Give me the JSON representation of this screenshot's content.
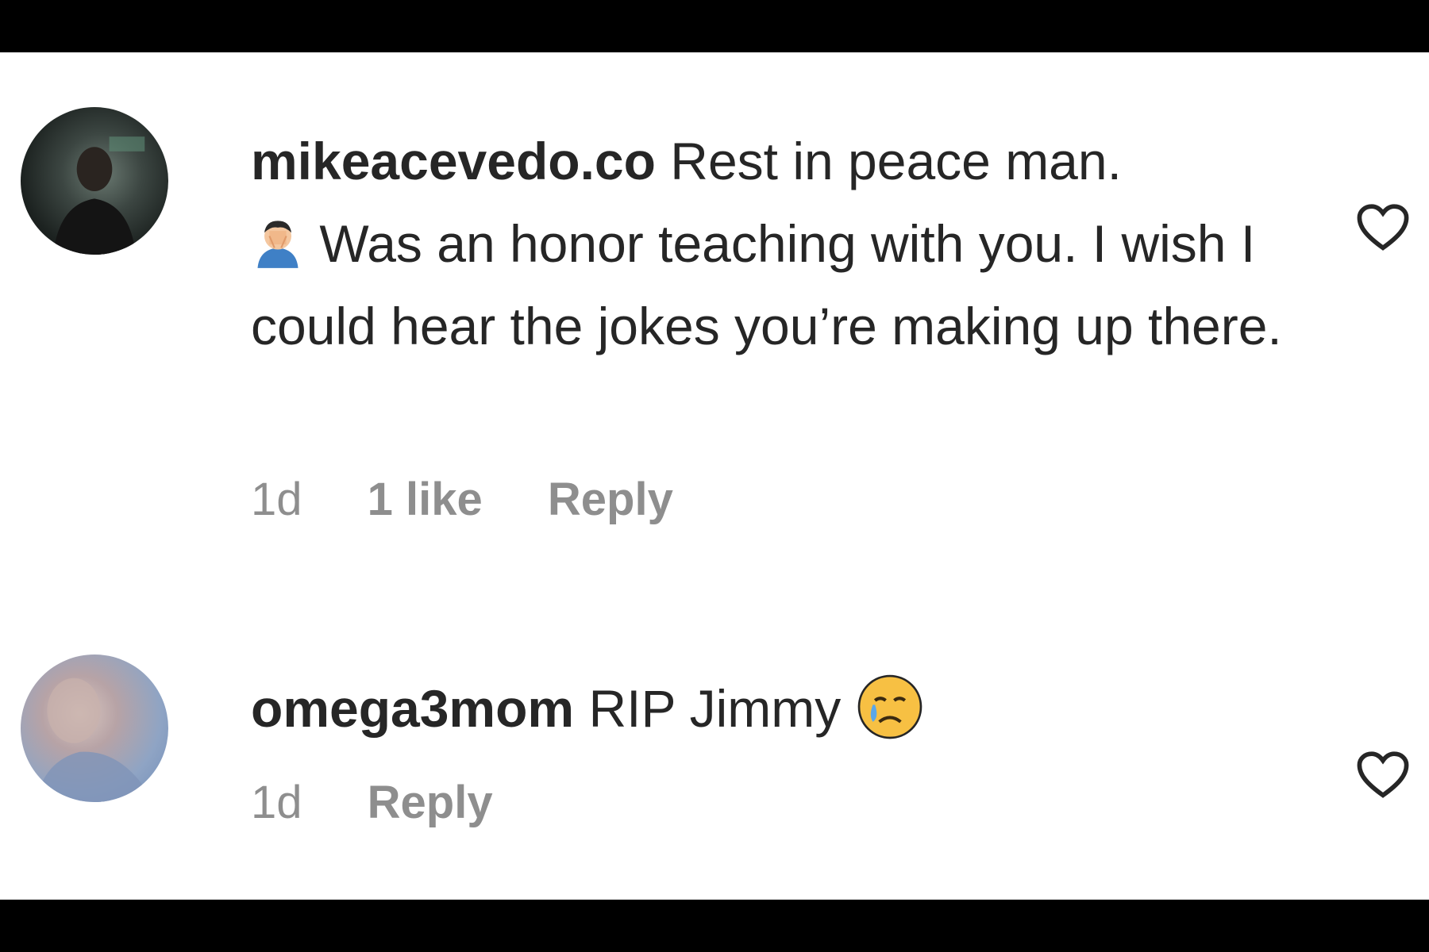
{
  "comments": [
    {
      "username": "mikeacevedo.co",
      "text_part1": "Rest in peace man.",
      "emoji1": "person-facepalming",
      "text_part2": "Was an honor teaching with you. I wish I could hear the jokes you’re making up there.",
      "time": "1d",
      "likes": "1 like",
      "reply_label": "Reply",
      "like_icon": "heart-outline-icon"
    },
    {
      "username": "omega3mom",
      "text_part1": "RIP Jimmy",
      "emoji1": "crying-face",
      "time": "1d",
      "reply_label": "Reply",
      "like_icon": "heart-outline-icon"
    }
  ],
  "colors": {
    "text": "#262626",
    "meta": "#8e8e8e",
    "background": "#ffffff",
    "frame": "#000000"
  }
}
